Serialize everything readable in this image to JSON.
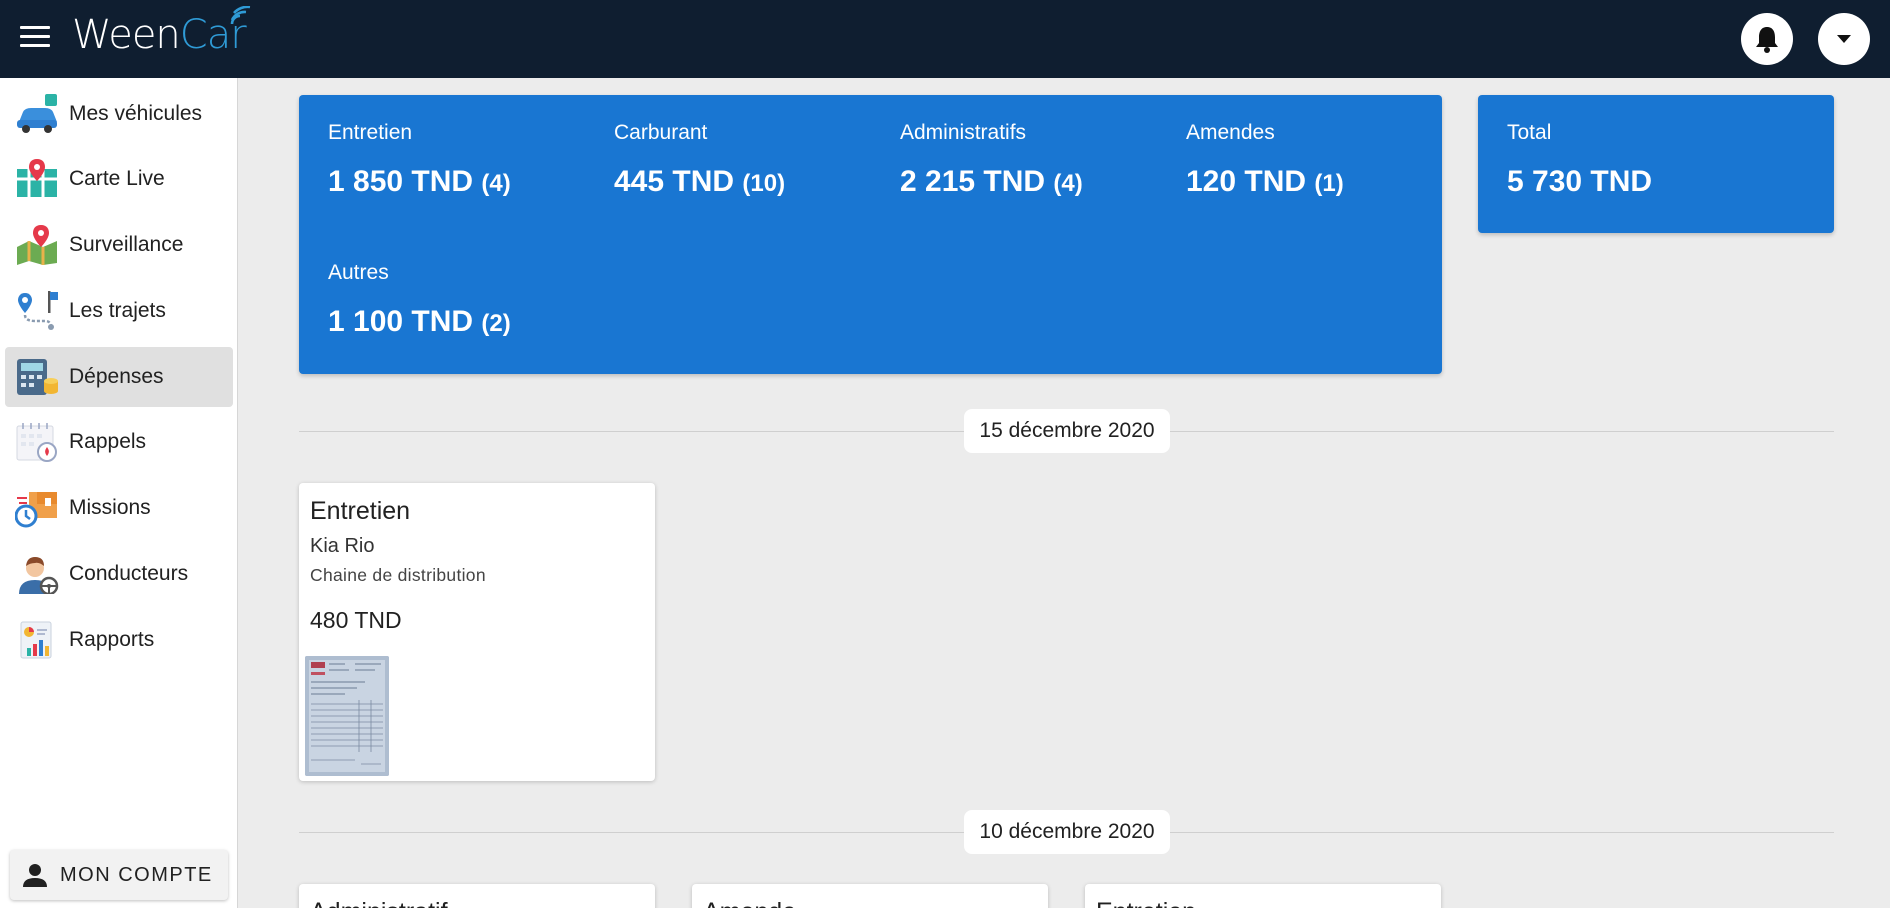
{
  "app": {
    "logo_text_a": "Ween",
    "logo_text_b": "Car"
  },
  "topbar": {
    "icons": [
      "menu-icon",
      "bell-icon",
      "caret-down-icon"
    ]
  },
  "sidebar": {
    "items": [
      {
        "label": "Mes véhicules",
        "icon": "vehicles-icon"
      },
      {
        "label": "Carte Live",
        "icon": "live-map-icon"
      },
      {
        "label": "Surveillance",
        "icon": "surveillance-icon"
      },
      {
        "label": "Les trajets",
        "icon": "trips-icon"
      },
      {
        "label": "Dépenses",
        "icon": "expenses-icon",
        "active": true
      },
      {
        "label": "Rappels",
        "icon": "reminders-icon"
      },
      {
        "label": "Missions",
        "icon": "missions-icon"
      },
      {
        "label": "Conducteurs",
        "icon": "drivers-icon"
      },
      {
        "label": "Rapports",
        "icon": "reports-icon"
      }
    ],
    "account_label": "MON COMPTE"
  },
  "summary": {
    "stats": [
      {
        "name": "Entretien",
        "amount": "1 850 TND",
        "count": "(4)"
      },
      {
        "name": "Carburant",
        "amount": "445 TND",
        "count": "(10)"
      },
      {
        "name": "Administratifs",
        "amount": "2 215 TND",
        "count": "(4)"
      },
      {
        "name": "Amendes",
        "amount": "120 TND",
        "count": "(1)"
      },
      {
        "name": "Autres",
        "amount": "1 100 TND",
        "count": "(2)"
      }
    ],
    "total": {
      "name": "Total",
      "amount": "5 730 TND"
    }
  },
  "groups": [
    {
      "date": "15 décembre 2020",
      "expenses": [
        {
          "type": "Entretien",
          "vehicle": "Kia Rio",
          "description": "Chaine de distribution",
          "amount": "480 TND"
        }
      ]
    },
    {
      "date": "10 décembre 2020",
      "expenses": [
        {
          "type": "Administratif"
        },
        {
          "type": "Amende"
        },
        {
          "type": "Entretien"
        }
      ]
    }
  ],
  "colors": {
    "topbar": "#0f1e30",
    "accent": "#1976d2",
    "logo_accent": "#2f9bd6"
  }
}
